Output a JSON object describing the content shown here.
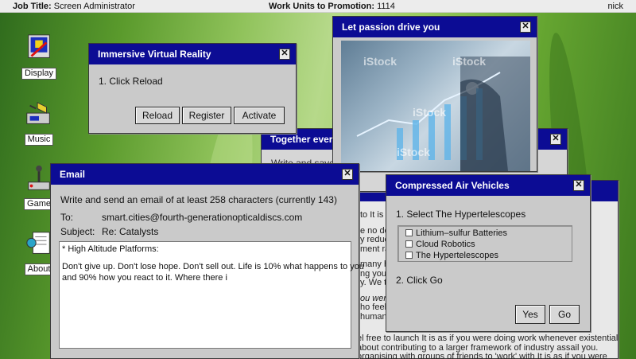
{
  "topbar": {
    "job_label": "Job Title:",
    "job_value": "Screen Administrator",
    "work_label": "Work Units to Promotion:",
    "work_value": "1114",
    "user": "nick"
  },
  "desktop_icons": [
    {
      "label": "Display",
      "icon": "display-icon"
    },
    {
      "label": "Music",
      "icon": "music-icon"
    },
    {
      "label": "Game",
      "icon": "game-icon"
    },
    {
      "label": "About",
      "icon": "about-icon"
    }
  ],
  "vr_window": {
    "title": "Immersive Virtual Reality",
    "step1": "1. Click Reload",
    "buttons": [
      "Reload",
      "Register",
      "Activate"
    ]
  },
  "passion_window": {
    "title": "Let passion drive you",
    "watermark": "iStock"
  },
  "together_window": {
    "title": "Together everyo",
    "partial_line": "Write and save a"
  },
  "email_window": {
    "title": "Email",
    "instruction": "Write and send an email of at least 258 characters (currently 143)",
    "to_label": "To:",
    "to_value": "smart.cities@fourth-generationopticaldiscs.com",
    "subject_label": "Subject:",
    "subject_value": "Re: Catalysts",
    "body_line1": "* High Altitude Platforms:",
    "body_line2": "Don't give up. Don't lose hope. Don't sell out. Life is 10% what happens to you",
    "body_line3": "and 90% how you react to it. Where there i"
  },
  "back_article": {
    "lines": [
      "to It is a",
      "e no dou",
      "y reduc",
      "ment ra",
      "many hu",
      "ng you",
      "y. We ta",
      "ou were",
      "ho feel",
      "human-"
    ],
    "bottom1": "el free to launch It is as if you were doing work whenever existential",
    "bottom2": "about contributing to a larger framework of industry assail you.",
    "bottom3": "organising with groups of friends to 'work' with It is as if you were"
  },
  "air_window": {
    "title": "Compressed Air Vehicles",
    "step1": "1. Select The Hypertelescopes",
    "options": [
      "Lithium–sulfur Batteries",
      "Cloud Robotics",
      "The Hypertelescopes"
    ],
    "step2": "2. Click Go",
    "buttons": [
      "Yes",
      "Go"
    ]
  },
  "close_glyph": "✕"
}
